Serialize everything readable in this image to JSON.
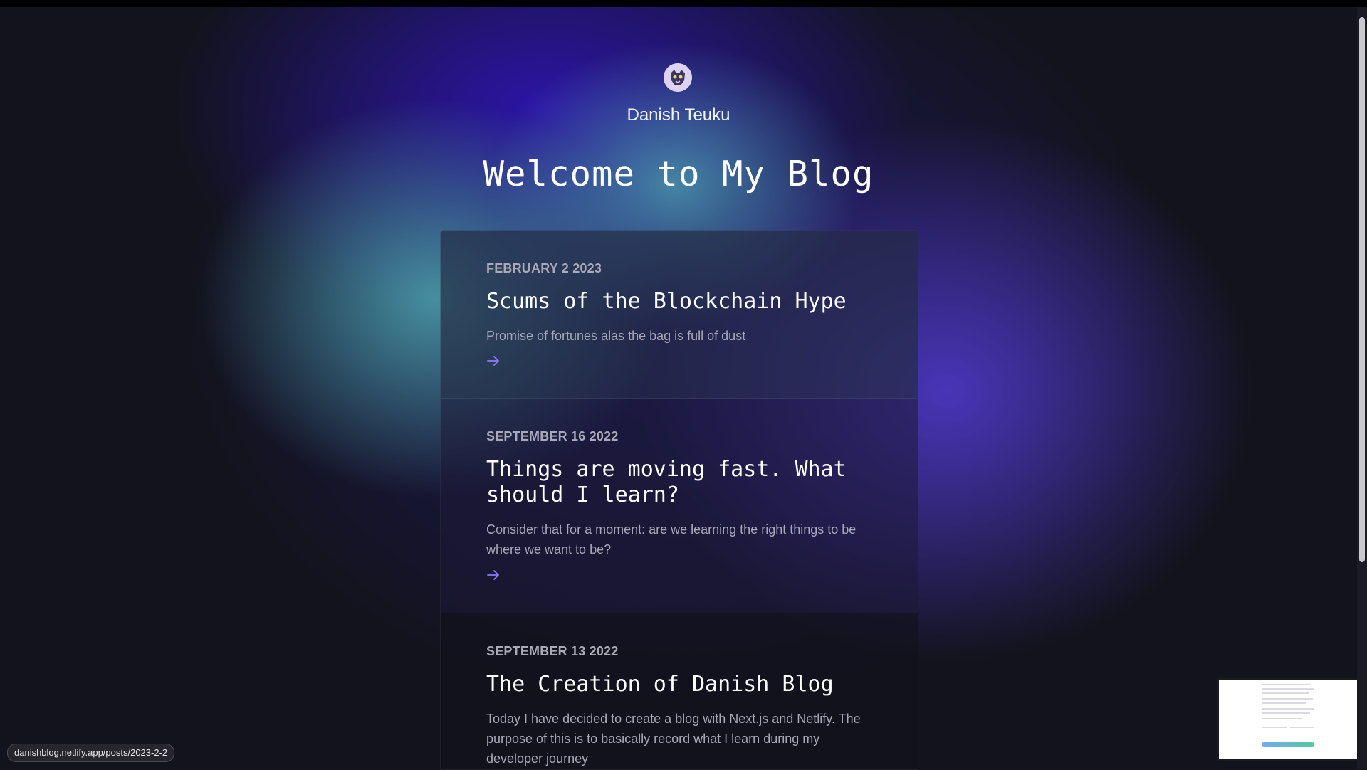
{
  "profile": {
    "author_name": "Danish Teuku"
  },
  "page": {
    "title": "Welcome to My Blog"
  },
  "posts": [
    {
      "date": "FEBRUARY 2 2023",
      "title": "Scums of the Blockchain Hype",
      "excerpt": "Promise of fortunes alas the bag is full of dust",
      "arrow_icon": "arrow-right-icon"
    },
    {
      "date": "SEPTEMBER 16 2022",
      "title": "Things are moving fast. What should I learn?",
      "excerpt": "Consider that for a moment: are we learning the right things to be where we want to be?",
      "arrow_icon": "arrow-right-icon"
    },
    {
      "date": "SEPTEMBER 13 2022",
      "title": "The Creation of Danish Blog",
      "excerpt": "Today I have decided to create a blog with Next.js and Netlify. The purpose of this is to basically record what I learn during my developer journey"
    }
  ],
  "status_bar": {
    "link_url": "danishblog.netlify.app/posts/2023-2-2"
  },
  "colors": {
    "accent": "#8b7cf6",
    "background": "#13131d",
    "text_muted": "#a8a8b8"
  }
}
